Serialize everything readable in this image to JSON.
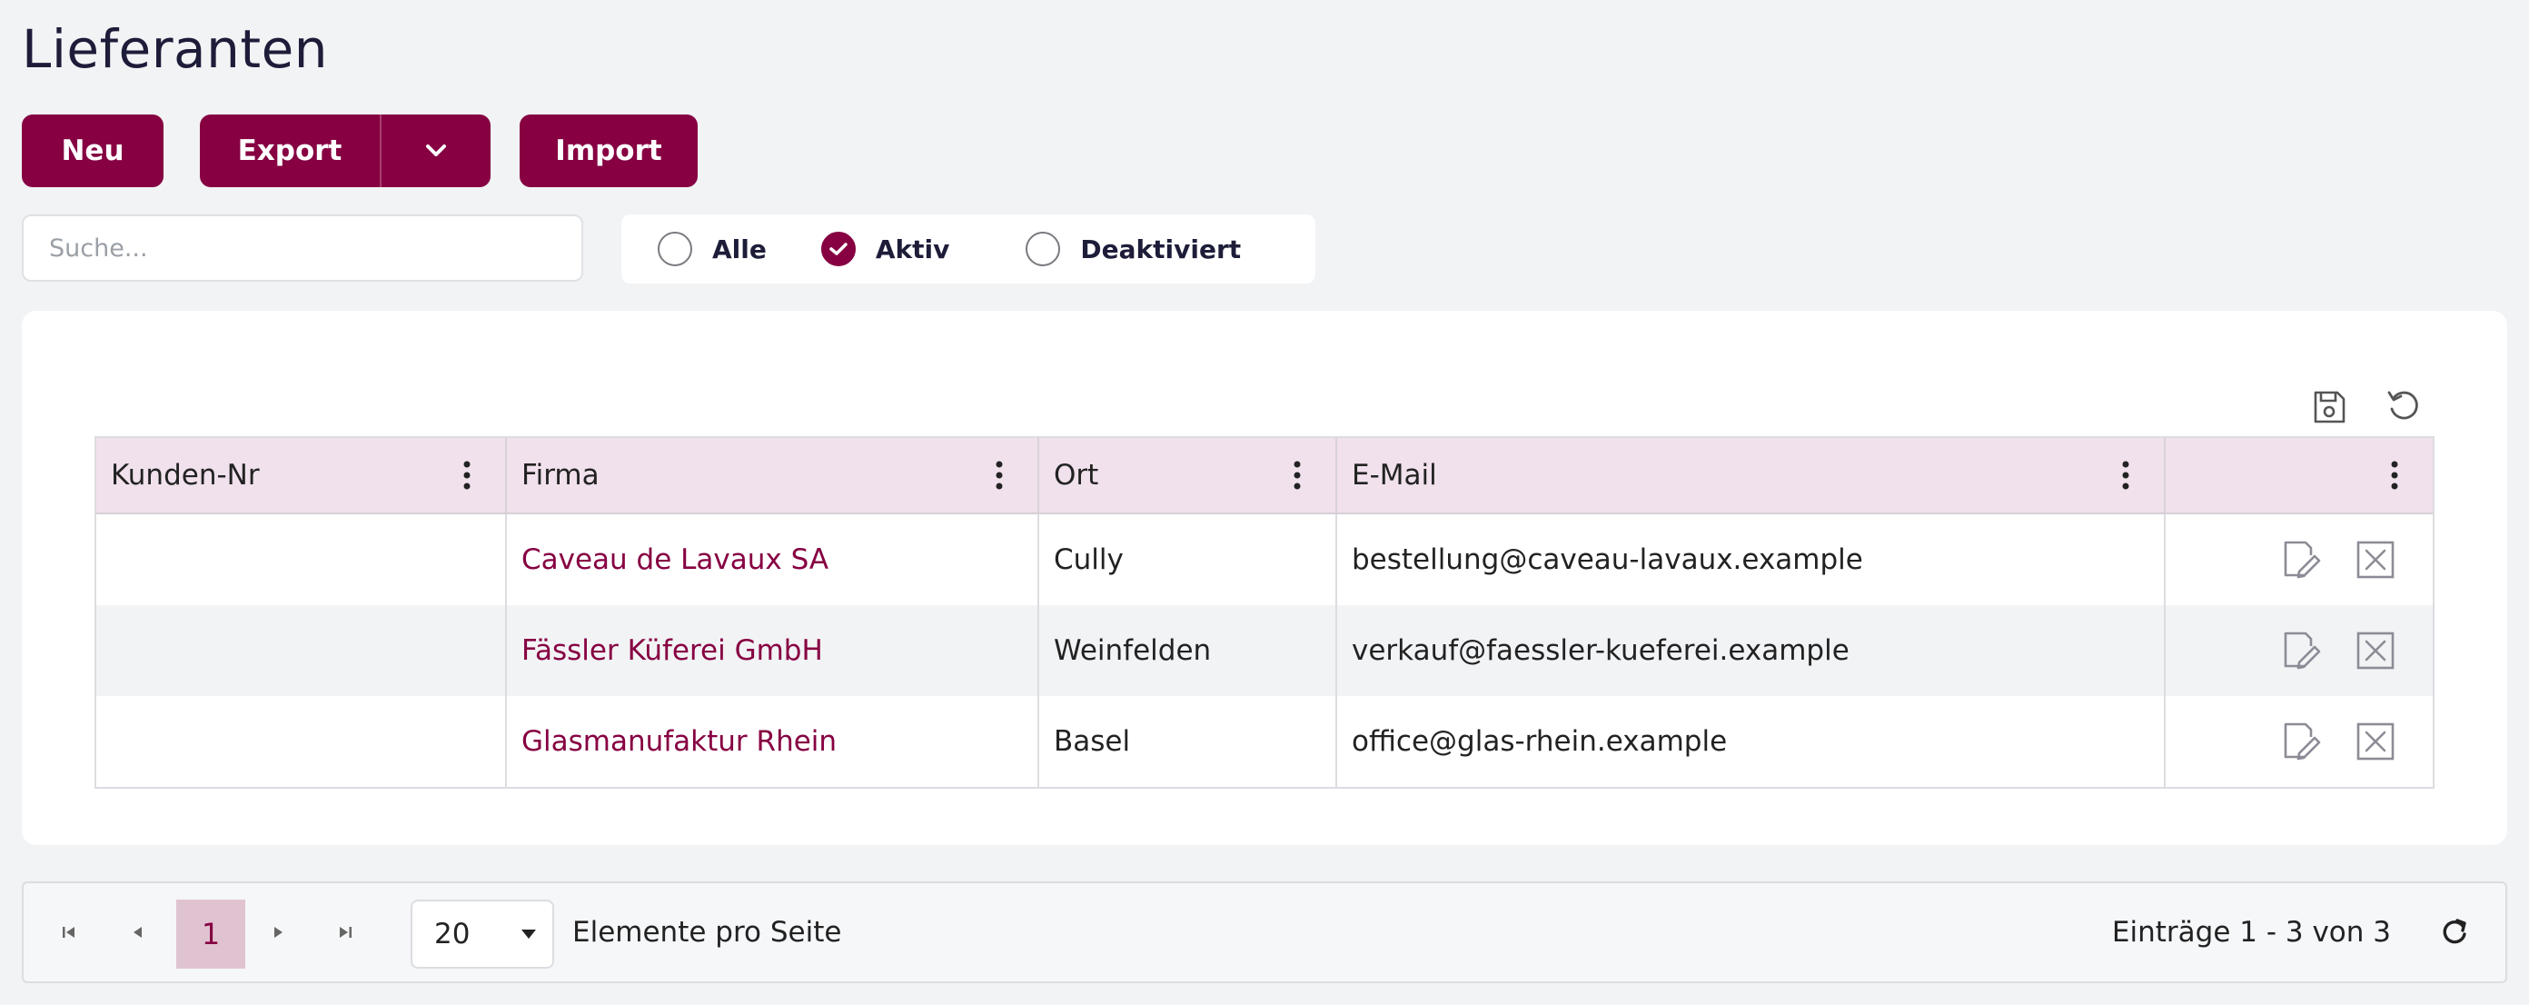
{
  "page": {
    "title": "Lieferanten"
  },
  "toolbar": {
    "new_label": "Neu",
    "export_label": "Export",
    "import_label": "Import"
  },
  "search": {
    "placeholder": "Suche...",
    "value": ""
  },
  "filter": {
    "options": [
      {
        "label": "Alle",
        "checked": false
      },
      {
        "label": "Aktiv",
        "checked": true
      },
      {
        "label": "Deaktiviert",
        "checked": false
      }
    ]
  },
  "table": {
    "columns": [
      "Kunden-Nr",
      "Firma",
      "Ort",
      "E-Mail",
      ""
    ],
    "rows": [
      {
        "kunden_nr": "",
        "firma": "Caveau de Lavaux SA",
        "ort": "Cully",
        "email": "bestellung@caveau-lavaux.example"
      },
      {
        "kunden_nr": "",
        "firma": "Fässler Küferei GmbH",
        "ort": "Weinfelden",
        "email": "verkauf@faessler-kueferei.example"
      },
      {
        "kunden_nr": "",
        "firma": "Glasmanufaktur Rhein",
        "ort": "Basel",
        "email": "office@glas-rhein.example"
      }
    ]
  },
  "pager": {
    "current_page": "1",
    "page_size": "20",
    "page_size_label": "Elemente pro Seite",
    "info": "Einträge 1 - 3 von 3"
  },
  "colors": {
    "accent": "#860042",
    "header_bg": "#f0e1ec",
    "page_bg": "#f2f3f5"
  },
  "icons": [
    "chevron-down-icon",
    "save-icon",
    "reset-icon",
    "kebab-icon",
    "edit-icon",
    "delete-icon",
    "first-page-icon",
    "prev-page-icon",
    "next-page-icon",
    "last-page-icon",
    "refresh-icon"
  ]
}
